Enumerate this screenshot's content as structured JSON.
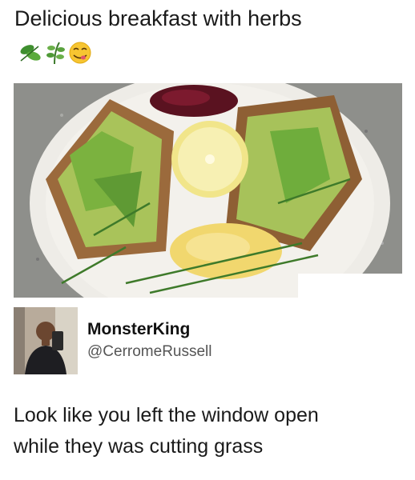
{
  "post": {
    "title": "Delicious breakfast with herbs",
    "emojis": [
      "herb-leaf-emoji",
      "herb-sprig-emoji",
      "yum-face-emoji"
    ]
  },
  "photo": {
    "subject": "food-photo"
  },
  "tweet": {
    "display_name": "MonsterKing",
    "handle": "@CerromeRussell",
    "text_line1": "Look like you left the window open",
    "text_line2": "while they was cutting grass"
  }
}
